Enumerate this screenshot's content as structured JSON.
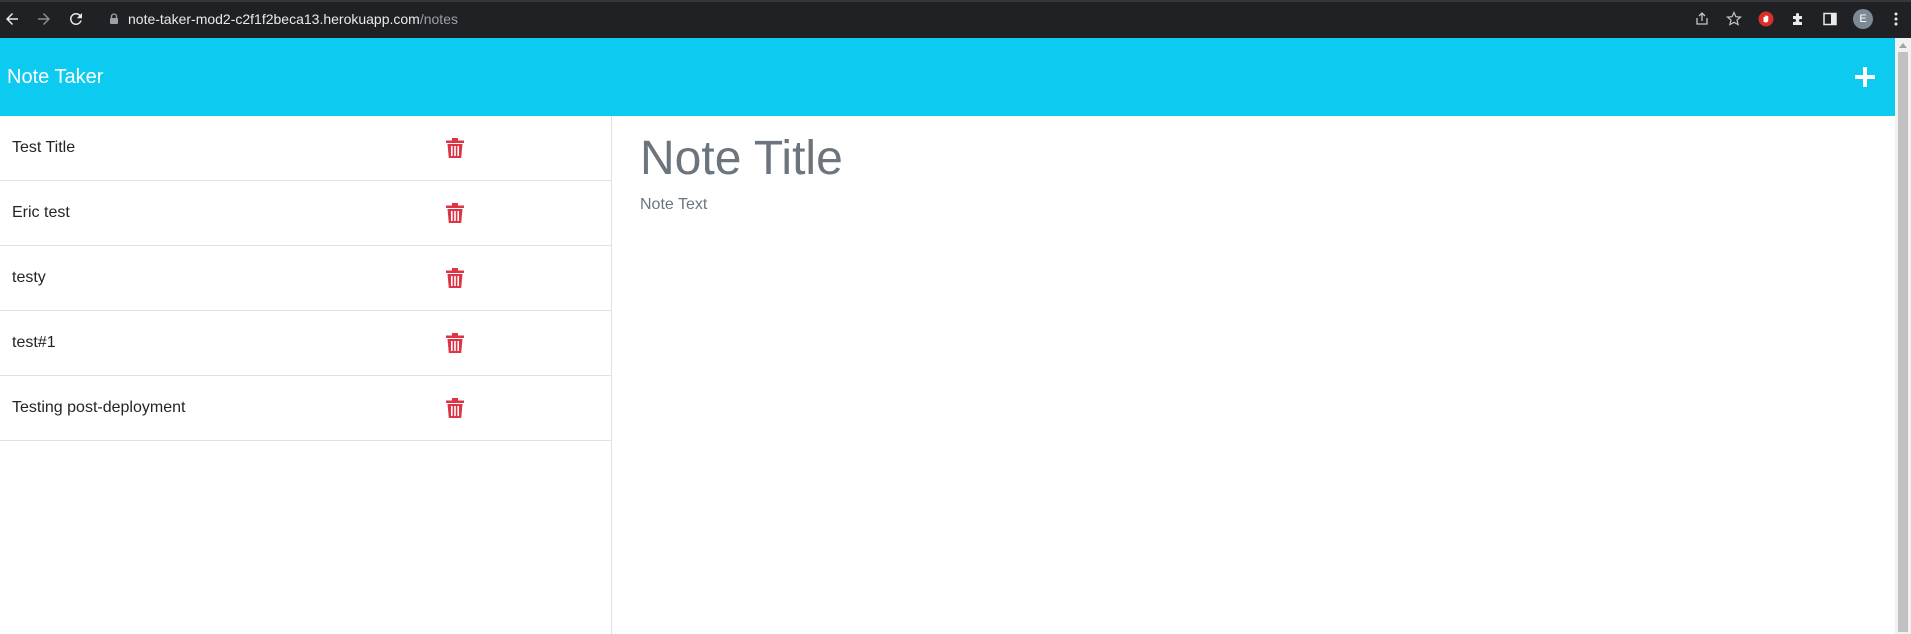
{
  "browser": {
    "url_host": "note-taker-mod2-c2f1f2beca13.herokuapp.com",
    "url_path": "/notes",
    "profile_initial": "E",
    "icons": [
      "back-arrow-icon",
      "forward-arrow-icon",
      "reload-icon",
      "lock-icon",
      "share-icon",
      "star-icon",
      "extension-icon",
      "puzzle-icon",
      "sidebar-icon",
      "more-vert-icon"
    ]
  },
  "app": {
    "brand": "Note Taker",
    "colors": {
      "navbar": "#0dcaf0",
      "delete": "#dc3545",
      "muted": "#6c757d"
    }
  },
  "notes": [
    {
      "title": "Test Title"
    },
    {
      "title": "Eric test"
    },
    {
      "title": "testy"
    },
    {
      "title": "test#1"
    },
    {
      "title": "Testing post-deployment"
    }
  ],
  "editor": {
    "title_placeholder": "Note Title",
    "text_placeholder": "Note Text"
  }
}
